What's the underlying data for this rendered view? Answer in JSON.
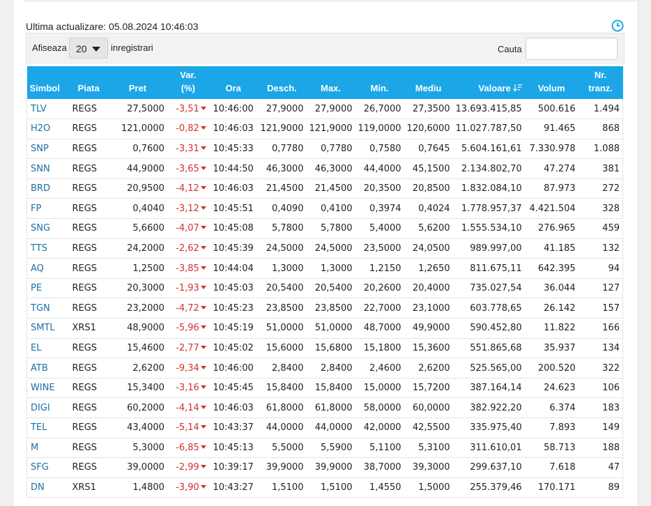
{
  "header": {
    "last_update_label": "Ultima actualizare:",
    "last_update_value": "05.08.2024 10:46:03"
  },
  "filter": {
    "show_label": "Afiseaza",
    "page_size": "20",
    "records_label": "inregistrari",
    "search_label": "Cauta",
    "search_value": ""
  },
  "columns": [
    {
      "line1": "",
      "line2": "Simbol"
    },
    {
      "line1": "",
      "line2": "Piata"
    },
    {
      "line1": "",
      "line2": "Pret"
    },
    {
      "line1": "Var.",
      "line2": "(%)"
    },
    {
      "line1": "",
      "line2": "Ora"
    },
    {
      "line1": "",
      "line2": "Desch."
    },
    {
      "line1": "",
      "line2": "Max."
    },
    {
      "line1": "",
      "line2": "Min."
    },
    {
      "line1": "",
      "line2": "Mediu"
    },
    {
      "line1": "",
      "line2": "Valoare"
    },
    {
      "line1": "",
      "line2": "Volum"
    },
    {
      "line1": "Nr.",
      "line2": "tranz."
    }
  ],
  "colors": {
    "header_bg": "#1ca6e8",
    "negative": "#d0312d",
    "symbol": "#1a6fa8"
  },
  "sort_icon": "sort-descending-icon",
  "rows": [
    [
      "TLV",
      "REGS",
      "27,5000",
      "-3,51",
      "10:46:00",
      "27,9000",
      "27,9000",
      "26,7000",
      "27,3500",
      "13.693.415,85",
      "500.616",
      "1.494"
    ],
    [
      "H2O",
      "REGS",
      "121,0000",
      "-0,82",
      "10:46:03",
      "121,9000",
      "121,9000",
      "119,0000",
      "120,6000",
      "11.027.787,50",
      "91.465",
      "868"
    ],
    [
      "SNP",
      "REGS",
      "0,7600",
      "-3,31",
      "10:45:33",
      "0,7780",
      "0,7780",
      "0,7580",
      "0,7645",
      "5.604.161,61",
      "7.330.978",
      "1.088"
    ],
    [
      "SNN",
      "REGS",
      "44,9000",
      "-3,65",
      "10:44:50",
      "46,3000",
      "46,3000",
      "44,4000",
      "45,1500",
      "2.134.802,70",
      "47.274",
      "381"
    ],
    [
      "BRD",
      "REGS",
      "20,9500",
      "-4,12",
      "10:46:03",
      "21,4500",
      "21,4500",
      "20,3500",
      "20,8500",
      "1.832.084,10",
      "87.973",
      "272"
    ],
    [
      "FP",
      "REGS",
      "0,4040",
      "-3,12",
      "10:45:51",
      "0,4090",
      "0,4100",
      "0,3974",
      "0,4024",
      "1.778.957,37",
      "4.421.504",
      "328"
    ],
    [
      "SNG",
      "REGS",
      "5,6600",
      "-4,07",
      "10:45:08",
      "5,7800",
      "5,7800",
      "5,4000",
      "5,6200",
      "1.555.534,10",
      "276.965",
      "459"
    ],
    [
      "TTS",
      "REGS",
      "24,2000",
      "-2,62",
      "10:45:39",
      "24,5000",
      "24,5000",
      "23,5000",
      "24,0500",
      "989.997,00",
      "41.185",
      "132"
    ],
    [
      "AQ",
      "REGS",
      "1,2500",
      "-3,85",
      "10:44:04",
      "1,3000",
      "1,3000",
      "1,2150",
      "1,2650",
      "811.675,11",
      "642.395",
      "94"
    ],
    [
      "PE",
      "REGS",
      "20,3000",
      "-1,93",
      "10:45:03",
      "20,5400",
      "20,5400",
      "20,2600",
      "20,4000",
      "735.027,54",
      "36.044",
      "127"
    ],
    [
      "TGN",
      "REGS",
      "23,2000",
      "-4,72",
      "10:45:23",
      "23,8500",
      "23,8500",
      "22,7000",
      "23,1000",
      "603.778,65",
      "26.142",
      "157"
    ],
    [
      "SMTL",
      "XRS1",
      "48,9000",
      "-5,96",
      "10:45:19",
      "51,0000",
      "51,0000",
      "48,7000",
      "49,9000",
      "590.452,80",
      "11.822",
      "166"
    ],
    [
      "EL",
      "REGS",
      "15,4600",
      "-2,77",
      "10:45:02",
      "15,6000",
      "15,6800",
      "15,1800",
      "15,3600",
      "551.865,68",
      "35.937",
      "134"
    ],
    [
      "ATB",
      "REGS",
      "2,6200",
      "-9,34",
      "10:46:00",
      "2,8400",
      "2,8400",
      "2,4600",
      "2,6200",
      "525.565,00",
      "200.520",
      "322"
    ],
    [
      "WINE",
      "REGS",
      "15,3400",
      "-3,16",
      "10:45:45",
      "15,8400",
      "15,8400",
      "15,0000",
      "15,7200",
      "387.164,14",
      "24.623",
      "106"
    ],
    [
      "DIGI",
      "REGS",
      "60,2000",
      "-4,14",
      "10:46:03",
      "61,8000",
      "61,8000",
      "58,0000",
      "60,0000",
      "382.922,20",
      "6.374",
      "183"
    ],
    [
      "TEL",
      "REGS",
      "43,4000",
      "-5,14",
      "10:43:37",
      "44,0000",
      "44,0000",
      "42,0000",
      "42,5500",
      "335.975,40",
      "7.893",
      "149"
    ],
    [
      "M",
      "REGS",
      "5,3000",
      "-6,85",
      "10:45:13",
      "5,5000",
      "5,5900",
      "5,1100",
      "5,3100",
      "311.610,01",
      "58.713",
      "188"
    ],
    [
      "SFG",
      "REGS",
      "39,0000",
      "-2,99",
      "10:39:17",
      "39,9000",
      "39,9000",
      "38,7000",
      "39,3000",
      "299.637,10",
      "7.618",
      "47"
    ],
    [
      "DN",
      "XRS1",
      "1,4800",
      "-3,90",
      "10:43:27",
      "1,5100",
      "1,5100",
      "1,4550",
      "1,5000",
      "255.379,46",
      "170.171",
      "89"
    ]
  ]
}
